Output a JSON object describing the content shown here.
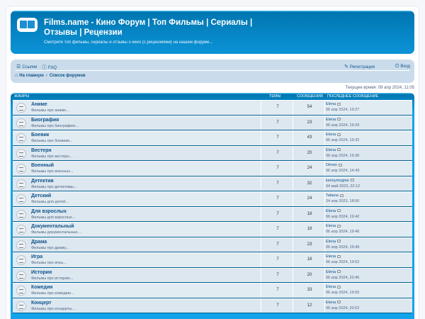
{
  "header": {
    "title": "Films.name - Кино Форум | Топ Фильмы | Сериалы | Отзывы | Рецензии",
    "description": "Смотрите топ фильмы, сериалы и отзывы о кино (с рецензиями) на нашем форуме..."
  },
  "nav": {
    "links_label": "Ссылки",
    "faq_label": "FAQ",
    "register_label": "Регистрация",
    "login_label": "Вход",
    "home_label": "На главную",
    "forum_list_label": "Список форумов"
  },
  "current_time": "Текущее время: 09 апр 2024, 11:05",
  "table": {
    "col_forum": "ЖАНРЫ",
    "col_topics": "ТЕМЫ",
    "col_posts": "СООБЩЕНИЯ",
    "col_last": "ПОСЛЕДНЕЕ СООБЩЕНИЕ"
  },
  "forums": [
    {
      "name": "Аниме",
      "desc": "Фильмы про аниме...",
      "topics": "7",
      "posts": "54",
      "user": "Elena",
      "date": "06 апр 2024, 19:27"
    },
    {
      "name": "Биография",
      "desc": "Фильмы про биографию...",
      "topics": "7",
      "posts": "23",
      "user": "Elena",
      "date": "06 апр 2024, 19:29"
    },
    {
      "name": "Боевик",
      "desc": "Фильмы про боевики...",
      "topics": "7",
      "posts": "43",
      "user": "Elena",
      "date": "06 апр 2024, 19:32"
    },
    {
      "name": "Вестерн",
      "desc": "Фильмы про вестерн...",
      "topics": "7",
      "posts": "20",
      "user": "Elena",
      "date": "06 апр 2024, 19:36"
    },
    {
      "name": "Военный",
      "desc": "Фильмы про военных...",
      "topics": "7",
      "posts": "24",
      "user": "Dimon",
      "date": "06 апр 2024, 14:43"
    },
    {
      "name": "Детектив",
      "desc": "Фильмы про детективы...",
      "topics": "7",
      "posts": "32",
      "user": "kennymogine",
      "date": "04 май 2023, 22:12"
    },
    {
      "name": "Детский",
      "desc": "Фильмы для детей...",
      "topics": "7",
      "posts": "24",
      "user": "Tatiana",
      "date": "24 апр 2023, 18:50"
    },
    {
      "name": "Для взрослых",
      "desc": "Фильмы для взрослых...",
      "topics": "7",
      "posts": "18",
      "user": "Elena",
      "date": "06 апр 2024, 19:42"
    },
    {
      "name": "Документальный",
      "desc": "Фильмы документальные...",
      "topics": "7",
      "posts": "18",
      "user": "Elena",
      "date": "06 апр 2024, 19:46"
    },
    {
      "name": "Драма",
      "desc": "Фильмы про драму...",
      "topics": "7",
      "posts": "23",
      "user": "Elena",
      "date": "06 апр 2024, 19:49"
    },
    {
      "name": "Игра",
      "desc": "Фильмы про игры...",
      "topics": "7",
      "posts": "18",
      "user": "Elena",
      "date": "06 апр 2024, 19:52"
    },
    {
      "name": "История",
      "desc": "Фильмы про историю...",
      "topics": "7",
      "posts": "20",
      "user": "Elena",
      "date": "06 апр 2024, 20:45"
    },
    {
      "name": "Комедия",
      "desc": "Фильмы про комедию...",
      "topics": "7",
      "posts": "33",
      "user": "Elena",
      "date": "06 апр 2024, 19:55"
    },
    {
      "name": "Концерт",
      "desc": "Фильмы про концерты...",
      "topics": "7",
      "posts": "12",
      "user": "Elena",
      "date": "06 апр 2024, 20:02"
    }
  ]
}
